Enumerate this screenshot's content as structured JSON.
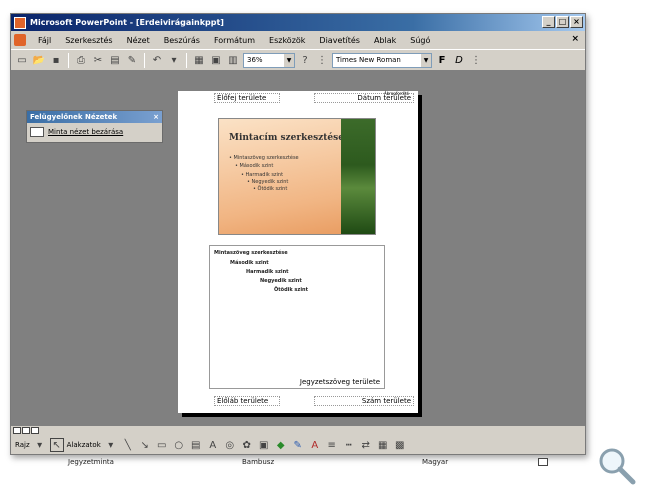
{
  "window": {
    "title": "Microsoft PowerPoint - [Erdeivirágainkppt]",
    "title_buttons": [
      "_",
      "□",
      "×"
    ]
  },
  "menubar": {
    "items": [
      "Fájl",
      "Szerkesztés",
      "Nézet",
      "Beszúrás",
      "Formátum",
      "Eszközök",
      "Diavetítés",
      "Ablak",
      "Súgó"
    ],
    "close": "×"
  },
  "toolbar": {
    "zoom": "36%",
    "font": "Times New Roman",
    "bold": "F",
    "italic": "D"
  },
  "taskpane": {
    "title": "Felügyelőnek Nézetek",
    "close": "×",
    "item": "Minta nézet bezárása"
  },
  "page": {
    "header_area": "Élőfej területe",
    "date_area": "Dátum területe",
    "header_small": "Ábrapfordító",
    "slide_title": "Mintacím szerkesztése",
    "slide_lines": [
      "• Mintaszöveg szerkesztése",
      "• Második szint",
      "• Harmadik szint",
      "• Negyedik szint",
      "• Ötödik szint"
    ],
    "notes_lines": [
      "Mintaszöveg szerkesztése",
      "Második szint",
      "Harmadik szint",
      "Negyedik szint",
      "Ötödik szint"
    ],
    "notes_area": "Jegyzetszöveg területe",
    "footer_area": "Élőláb területe",
    "number_area": "Szám területe"
  },
  "drawbar": {
    "drawing": "Rajz",
    "autoshapes": "Alakzatok"
  },
  "statusbar": {
    "left": "Jegyzetminta",
    "mid": "Bambusz",
    "right": "Magyar"
  }
}
